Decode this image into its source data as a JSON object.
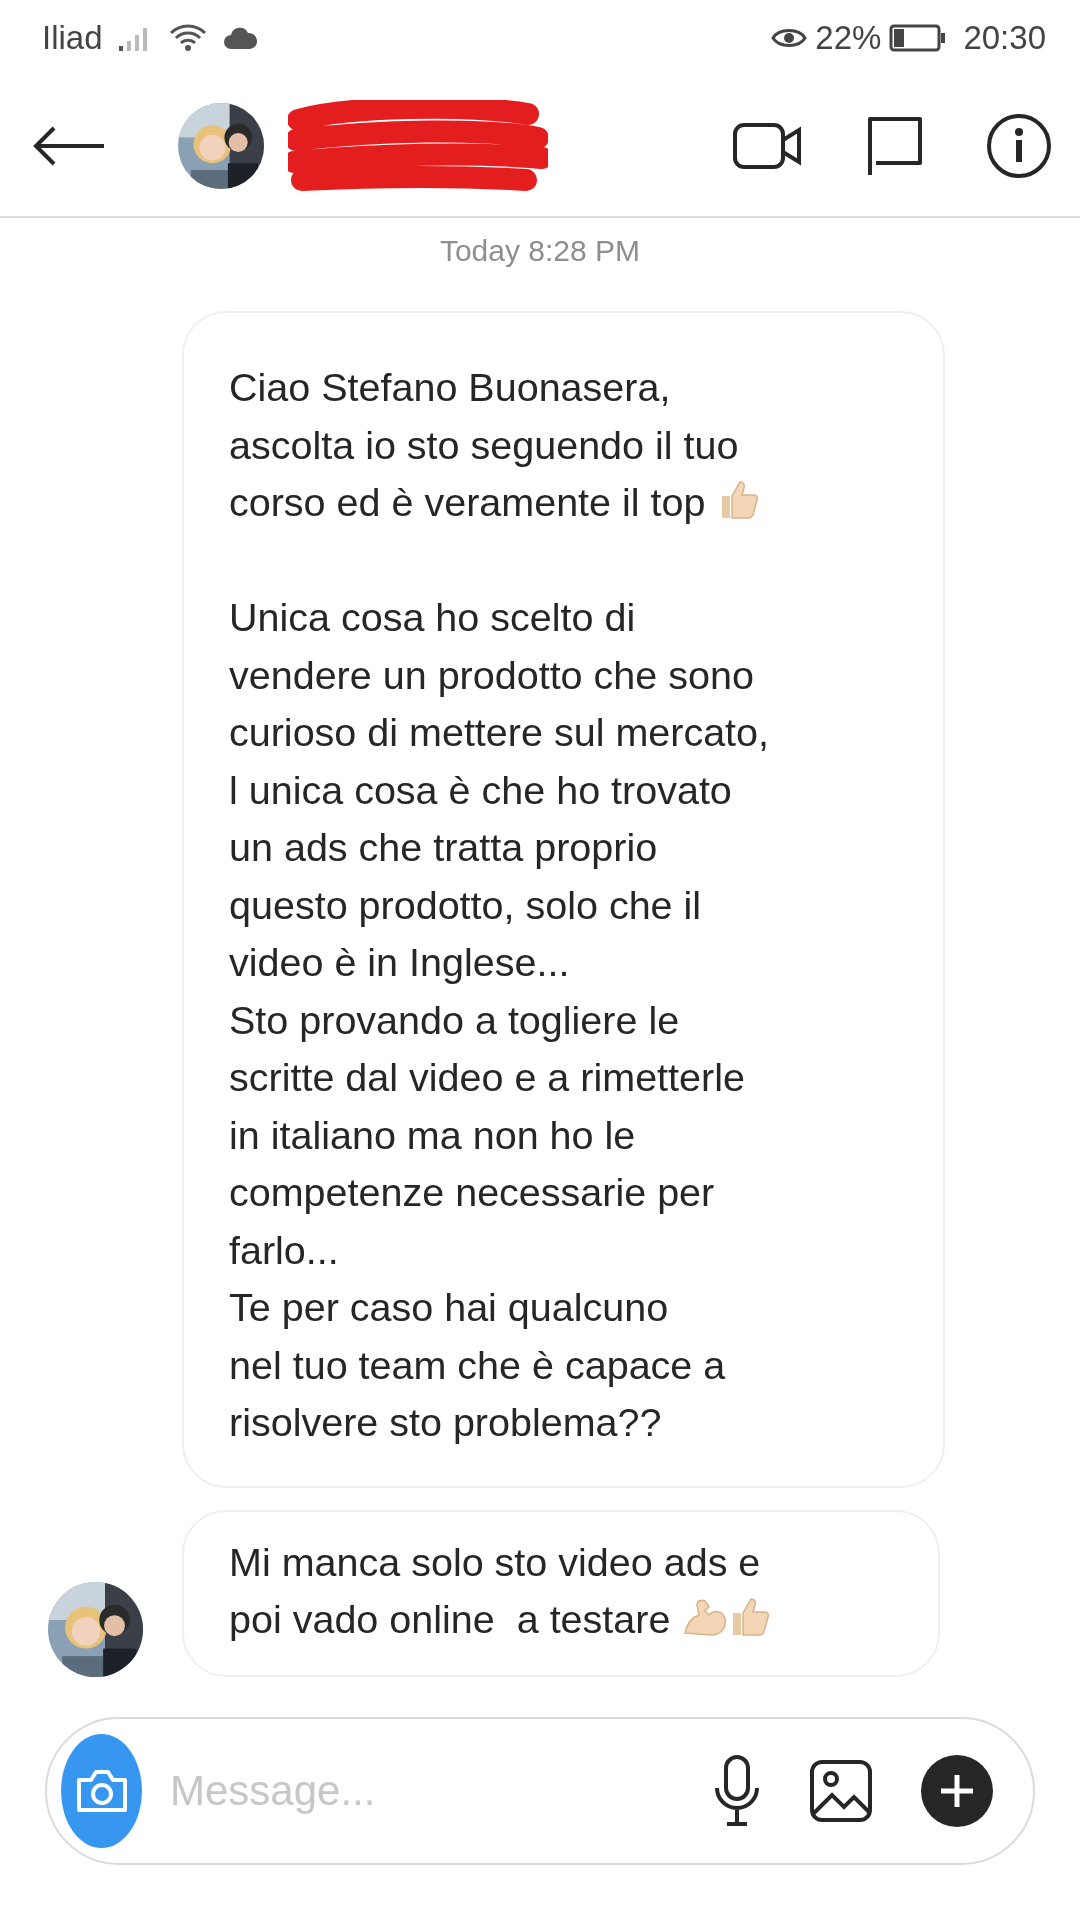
{
  "status_bar": {
    "carrier": "Iliad",
    "battery": "22%",
    "time": "20:30"
  },
  "header": {
    "kind": "chat"
  },
  "timestamp": "Today 8:28 PM",
  "messages": [
    {
      "avatar": false,
      "segments": [
        {
          "kind": "text",
          "text": "Ciao Stefano Buonasera,\nascolta io sto seguendo il tuo\ncorso ed è veramente il top "
        },
        {
          "kind": "thumbs_up"
        },
        {
          "kind": "text",
          "text": "\n\nUnica cosa ho scelto di\nvendere un prodotto che sono\ncurioso di mettere sul mercato,\nl unica cosa è che ho trovato\nun ads che tratta proprio\nquesto prodotto, solo che il\nvideo è in Inglese...\nSto provando a togliere le\nscritte dal video e a rimetterle\nin italiano ma non ho le\ncompetenze necessarie per\nfarlo...\nTe per caso hai qualcuno\nnel tuo team che è capace a\nrisolvere sto problema??"
        }
      ]
    },
    {
      "avatar": true,
      "segments": [
        {
          "kind": "text",
          "text": "Mi manca solo sto video ads e\npoi vado online  a testare "
        },
        {
          "kind": "flexed_arm"
        },
        {
          "kind": "thumbs_up"
        }
      ]
    }
  ],
  "composer": {
    "placeholder": "Message..."
  }
}
